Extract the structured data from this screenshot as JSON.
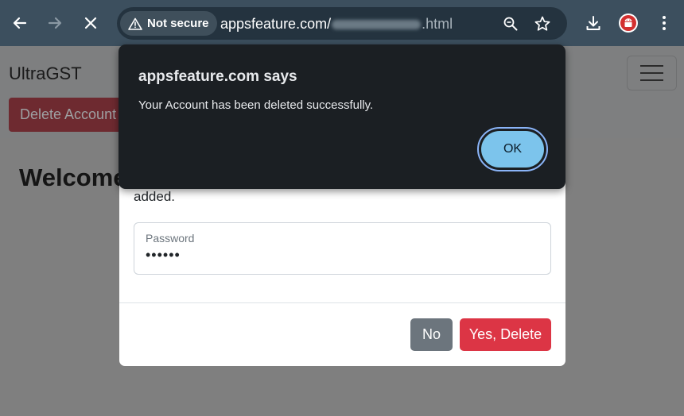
{
  "browser": {
    "security_label": "Not secure",
    "url_host": "appsfeature.com/",
    "url_suffix": ".html"
  },
  "page": {
    "brand": "UltraGST",
    "delete_account_label": "Delete Account",
    "welcome_heading": "Welcome"
  },
  "modal": {
    "text_fragment": "added.",
    "password_label": "Password",
    "password_value": "••••••",
    "no_label": "No",
    "yes_label": "Yes, Delete"
  },
  "alert": {
    "title": "appsfeature.com says",
    "message": "Your Account has been deleted successfully.",
    "ok_label": "OK"
  },
  "colors": {
    "chrome_bg": "#3c4f5e",
    "danger": "#dc3545",
    "secondary": "#6c757d",
    "ok_button": "#7cc4ec"
  }
}
